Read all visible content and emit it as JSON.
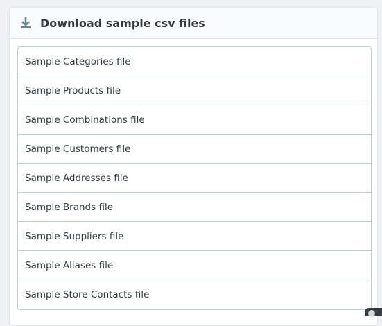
{
  "panel": {
    "title": "Download sample csv files",
    "icon": "download-icon"
  },
  "files": [
    {
      "label": "Sample Categories file"
    },
    {
      "label": "Sample Products file"
    },
    {
      "label": "Sample Combinations file"
    },
    {
      "label": "Sample Customers file"
    },
    {
      "label": "Sample Addresses file"
    },
    {
      "label": "Sample Brands file"
    },
    {
      "label": "Sample Suppliers file"
    },
    {
      "label": "Sample Aliases file"
    },
    {
      "label": "Sample Store Contacts file"
    }
  ],
  "colors": {
    "text": "#363a41",
    "icon": "#6c868e",
    "border": "#bbcdd2",
    "background": "#eff1f2"
  }
}
